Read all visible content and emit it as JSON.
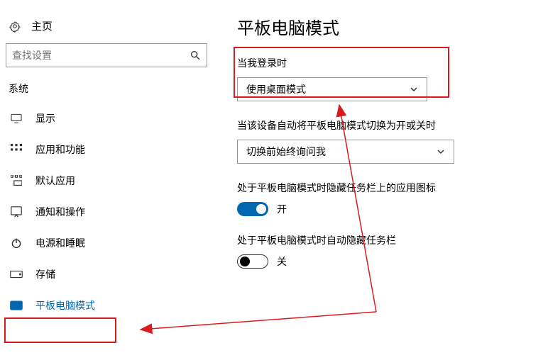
{
  "home_label": "主页",
  "search_placeholder": "查找设置",
  "section_title": "系统",
  "sidebar_items": [
    {
      "label": "显示"
    },
    {
      "label": "应用和功能"
    },
    {
      "label": "默认应用"
    },
    {
      "label": "通知和操作"
    },
    {
      "label": "电源和睡眠"
    },
    {
      "label": "存储"
    },
    {
      "label": "平板电脑模式"
    }
  ],
  "page_title": "平板电脑模式",
  "login": {
    "label": "当我登录时",
    "value": "使用桌面模式"
  },
  "auto_switch": {
    "label": "当该设备自动将平板电脑模式切换为开或关时",
    "value": "切换前始终询问我"
  },
  "hide_icons": {
    "label": "处于平板电脑模式时隐藏任务栏上的应用图标",
    "state": "开"
  },
  "hide_taskbar": {
    "label": "处于平板电脑模式时自动隐藏任务栏",
    "state": "关"
  }
}
